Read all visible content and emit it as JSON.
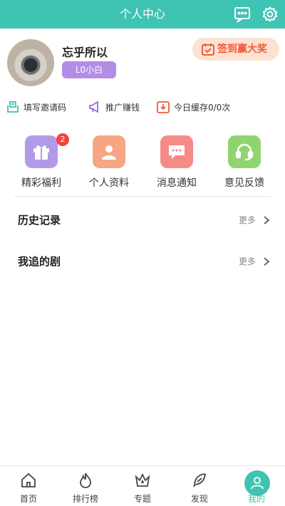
{
  "header": {
    "title": "个人中心",
    "message_icon": "message-icon",
    "settings_icon": "gear-icon"
  },
  "profile": {
    "username": "忘乎所以",
    "level": "L0小白",
    "checkin_label": "签到赢大奖"
  },
  "quick_actions": [
    {
      "label": "填写邀请码",
      "icon": "invite-code-icon"
    },
    {
      "label": "推广赚钱",
      "icon": "megaphone-icon"
    },
    {
      "label": "今日缓存0/0次",
      "icon": "download-icon"
    }
  ],
  "feature_grid": [
    {
      "label": "精彩福利",
      "icon": "gift-icon",
      "badge": "2",
      "color": "#b39ae9"
    },
    {
      "label": "个人资料",
      "icon": "user-icon",
      "color": "#f7a583"
    },
    {
      "label": "消息通知",
      "icon": "chat-icon",
      "color": "#f68a86"
    },
    {
      "label": "意见反馈",
      "icon": "headset-icon",
      "color": "#8fd46f"
    }
  ],
  "sections": [
    {
      "title": "历史记录",
      "more": "更多"
    },
    {
      "title": "我追的剧",
      "more": "更多"
    }
  ],
  "tabbar": [
    {
      "label": "首页",
      "icon": "home-icon"
    },
    {
      "label": "排行榜",
      "icon": "flame-icon"
    },
    {
      "label": "专题",
      "icon": "crown-icon"
    },
    {
      "label": "发现",
      "icon": "feather-icon"
    },
    {
      "label": "我的",
      "icon": "profile-icon",
      "active": true
    }
  ],
  "colors": {
    "accent": "#3fc3b3",
    "checkin_text": "#f35a3c",
    "badge": "#f4433f"
  }
}
